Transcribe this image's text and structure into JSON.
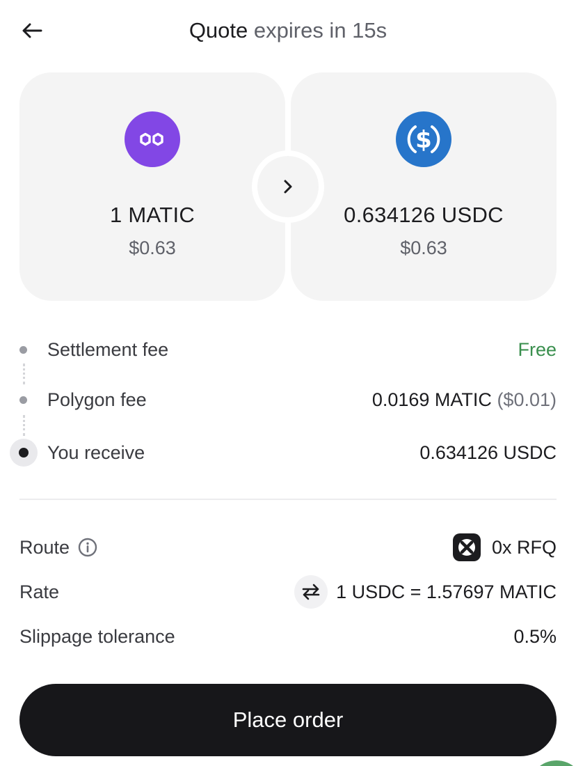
{
  "header": {
    "title_strong": "Quote",
    "title_muted": "expires in 15s"
  },
  "from_token": {
    "symbol": "MATIC",
    "icon": "polygon-icon",
    "amount": "1 MATIC",
    "fiat": "$0.63"
  },
  "to_token": {
    "symbol": "USDC",
    "icon": "usdc-icon",
    "amount": "0.634126 USDC",
    "fiat": "$0.63"
  },
  "fees": [
    {
      "label": "Settlement fee",
      "value": "Free"
    },
    {
      "label": "Polygon fee",
      "value": "0.0169 MATIC",
      "value_fiat": "($0.01)"
    },
    {
      "label": "You receive",
      "value": "0.634126 USDC"
    }
  ],
  "details": {
    "route_label": "Route",
    "route_value": "0x RFQ",
    "rate_label": "Rate",
    "rate_value": "1 USDC = 1.57697 MATIC",
    "slippage_label": "Slippage tolerance",
    "slippage_value": "0.5%"
  },
  "actions": {
    "place_order": "Place order"
  },
  "colors": {
    "matic": "#8247e5",
    "usdc": "#2775ca",
    "free": "#3a8f4e",
    "button": "#17171a"
  }
}
